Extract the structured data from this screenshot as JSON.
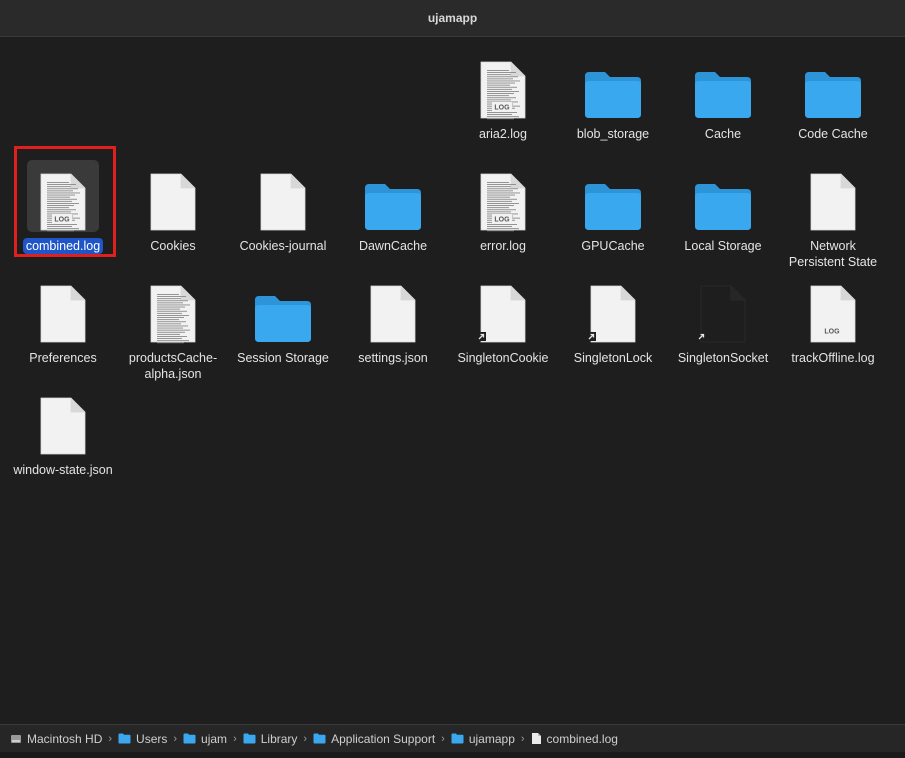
{
  "window": {
    "title": "ujamapp"
  },
  "items": [
    {
      "name": "aria2.log",
      "kind": "log"
    },
    {
      "name": "blob_storage",
      "kind": "folder"
    },
    {
      "name": "Cache",
      "kind": "folder"
    },
    {
      "name": "Code Cache",
      "kind": "folder"
    },
    {
      "name": "combined.log",
      "kind": "log",
      "selected": true
    },
    {
      "name": "Cookies",
      "kind": "doc"
    },
    {
      "name": "Cookies-journal",
      "kind": "doc"
    },
    {
      "name": "DawnCache",
      "kind": "folder"
    },
    {
      "name": "error.log",
      "kind": "log"
    },
    {
      "name": "GPUCache",
      "kind": "folder"
    },
    {
      "name": "Local Storage",
      "kind": "folder"
    },
    {
      "name": "Network Persistent State",
      "kind": "doc"
    },
    {
      "name": "Preferences",
      "kind": "doc"
    },
    {
      "name": "productsCache-alpha.json",
      "kind": "json-preview"
    },
    {
      "name": "Session Storage",
      "kind": "folder"
    },
    {
      "name": "settings.json",
      "kind": "doc"
    },
    {
      "name": "SingletonCookie",
      "kind": "alias"
    },
    {
      "name": "SingletonLock",
      "kind": "alias"
    },
    {
      "name": "SingletonSocket",
      "kind": "alias-dark"
    },
    {
      "name": "trackOffline.log",
      "kind": "log-blank"
    },
    {
      "name": "window-state.json",
      "kind": "doc"
    }
  ],
  "badge_text": "LOG",
  "path_bar": [
    {
      "label": "Macintosh HD",
      "icon": "disk-icon"
    },
    {
      "label": "Users",
      "icon": "folder-icon"
    },
    {
      "label": "ujam",
      "icon": "folder-icon"
    },
    {
      "label": "Library",
      "icon": "folder-icon"
    },
    {
      "label": "Application Support",
      "icon": "folder-icon"
    },
    {
      "label": "ujamapp",
      "icon": "folder-icon"
    },
    {
      "label": "combined.log",
      "icon": "file-icon"
    }
  ],
  "colors": {
    "folder": "#3aa8ee",
    "selection": "#1f55c7",
    "highlight_box": "#e0201f"
  }
}
